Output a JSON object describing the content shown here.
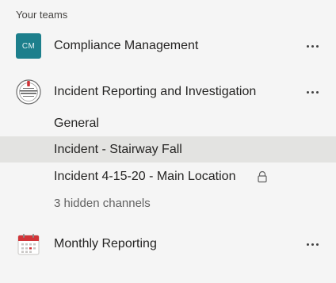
{
  "section": {
    "header": "Your teams"
  },
  "teams": [
    {
      "avatar_text": "CM",
      "avatar_icon": "teal-square-avatar",
      "name": "Compliance Management",
      "more_icon": "more-options-icon"
    },
    {
      "avatar_text": "INCIDENT REPORTING",
      "avatar_icon": "incident-reporting-logo",
      "name": "Incident Reporting and Investigation",
      "more_icon": "more-options-icon",
      "channels": [
        {
          "name": "General",
          "selected": false
        },
        {
          "name": "Incident - Stairway Fall",
          "selected": true
        },
        {
          "name": "Incident 4-15-20 - Main Location",
          "private": true,
          "icon": "lock-icon"
        }
      ],
      "hidden_channels": "3 hidden channels"
    },
    {
      "avatar_icon": "calendar-icon",
      "name": "Monthly Reporting",
      "more_icon": "more-options-icon"
    }
  ],
  "colors": {
    "background": "#f5f5f5",
    "selected_row": "#e3e3e1",
    "cm_avatar": "#1d7f8c",
    "calendar_red": "#d13438"
  }
}
